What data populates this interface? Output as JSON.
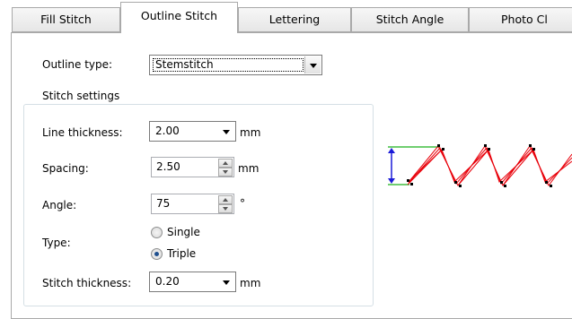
{
  "tabs": [
    {
      "label": "Fill Stitch"
    },
    {
      "label": "Outline Stitch"
    },
    {
      "label": "Lettering"
    },
    {
      "label": "Stitch Angle"
    },
    {
      "label": "Photo Cl"
    }
  ],
  "active_tab_index": 1,
  "outline_type": {
    "label": "Outline type:",
    "value": "Stemstitch"
  },
  "stitch_settings": {
    "title": "Stitch settings",
    "line_thickness": {
      "label": "Line thickness:",
      "value": "2.00",
      "unit": "mm"
    },
    "spacing": {
      "label": "Spacing:",
      "value": "2.50",
      "unit": "mm"
    },
    "angle": {
      "label": "Angle:",
      "value": "75",
      "unit": "°"
    },
    "type": {
      "label": "Type:",
      "options": [
        {
          "label": "Single",
          "selected": false
        },
        {
          "label": "Triple",
          "selected": true
        }
      ]
    },
    "stitch_thickness": {
      "label": "Stitch thickness:",
      "value": "0.20",
      "unit": "mm"
    }
  },
  "colors": {
    "stitch": "#e8000a",
    "guide": "#1bb01b",
    "arrow": "#1a1ad8",
    "radio_selected": "#1f4f8e"
  },
  "icons": [
    "chevron-down-icon",
    "spin-up-icon",
    "spin-down-icon",
    "stitch-preview-icon"
  ]
}
